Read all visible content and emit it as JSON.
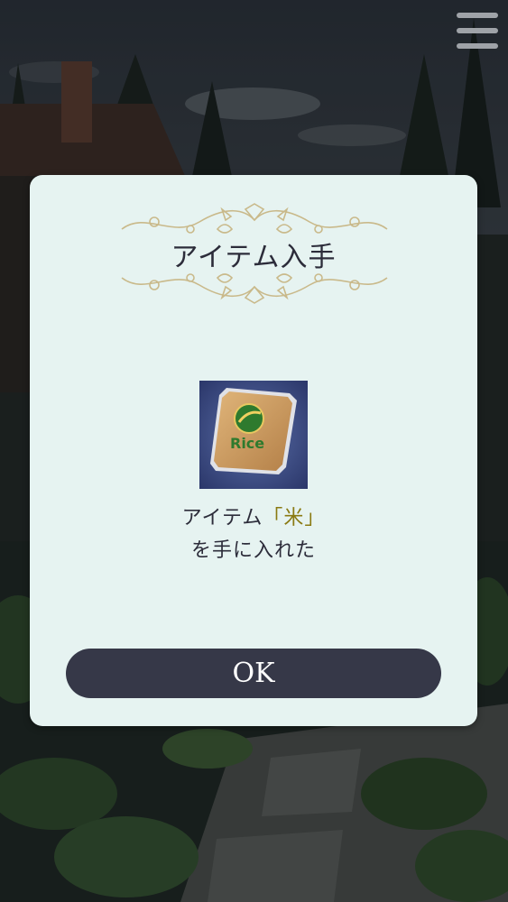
{
  "dialog": {
    "title": "アイテム入手",
    "message_prefix": "アイテム",
    "item_open_bracket": "「",
    "item_name": "米",
    "item_close_bracket": "」",
    "message_suffix": "を手に入れた",
    "ok_label": "OK"
  },
  "item_icon": {
    "name": "rice-bag-icon",
    "label": "Rice"
  },
  "colors": {
    "dialog_bg": "#e6f3f1",
    "button_bg": "#363848",
    "highlight": "#8a7a12",
    "ornament": "#c9b98a"
  }
}
